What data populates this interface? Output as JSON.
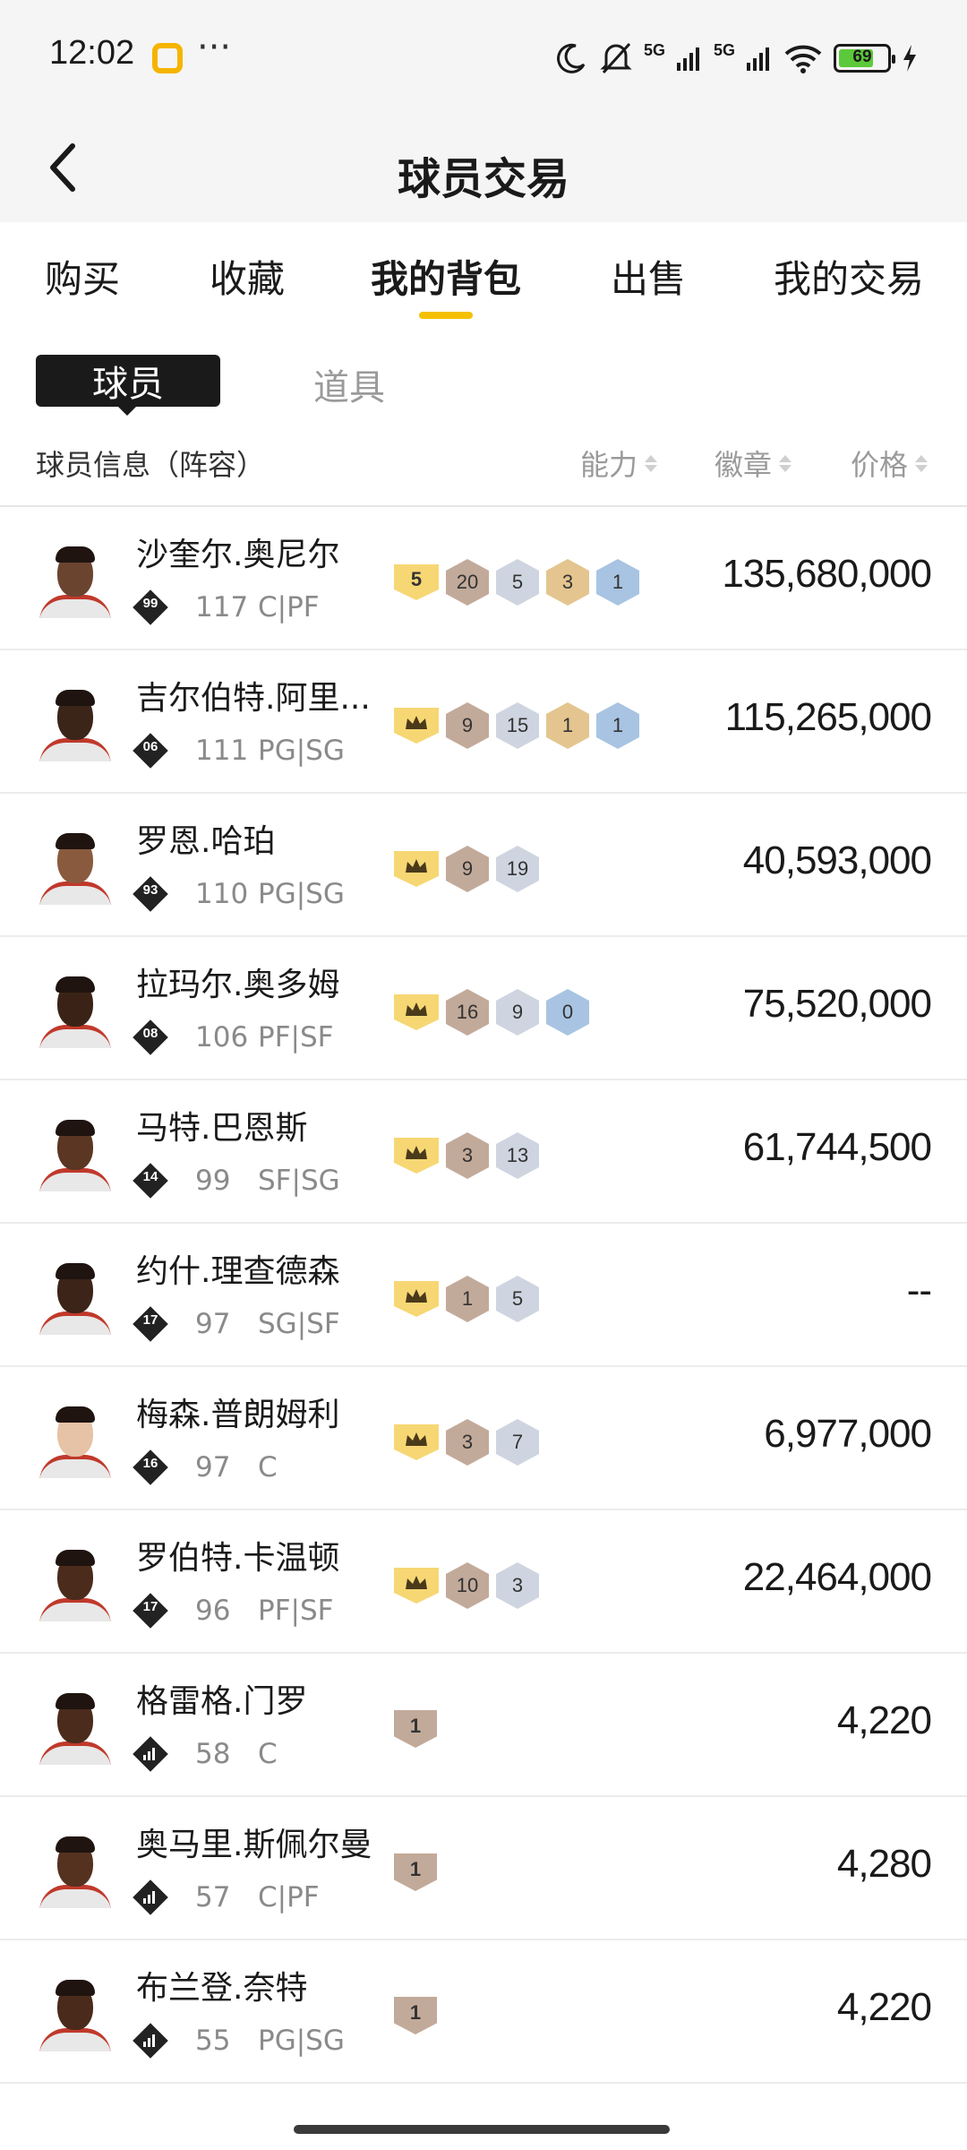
{
  "status_bar": {
    "time": "12:02",
    "battery": "69",
    "network_1": "5G",
    "network_2": "5G",
    "icons": [
      "moon-icon",
      "mute-bell-icon",
      "signal-icon",
      "wifi-icon",
      "battery-icon",
      "charging-icon"
    ]
  },
  "header": {
    "title": "球员交易",
    "back_icon": "chevron-left-icon"
  },
  "tabs": [
    {
      "label": "购买",
      "active": false
    },
    {
      "label": "收藏",
      "active": false
    },
    {
      "label": "我的背包",
      "active": true
    },
    {
      "label": "出售",
      "active": false
    },
    {
      "label": "我的交易",
      "active": false
    }
  ],
  "subtabs": {
    "players": "球员",
    "props": "道具"
  },
  "columns": {
    "info": "球员信息（阵容）",
    "ability": "能力",
    "badge": "徽章",
    "price": "价格"
  },
  "colors": {
    "accent": "#f5c000",
    "active_subtab_bg": "#1a1a1a"
  },
  "players": [
    {
      "name": "沙奎尔.奥尼尔",
      "level": "99",
      "ovr": "117",
      "position": "C|PF",
      "rank": "5",
      "badges": [
        {
          "type": "bronze",
          "count": "20"
        },
        {
          "type": "silver",
          "count": "5"
        },
        {
          "type": "gold",
          "count": "3"
        },
        {
          "type": "blue",
          "count": "1"
        }
      ],
      "price": "135,680,000"
    },
    {
      "name": "吉尔伯特.阿里...",
      "level": "06",
      "ovr": "111",
      "position": "PG|SG",
      "rank": "crown",
      "badges": [
        {
          "type": "bronze",
          "count": "9"
        },
        {
          "type": "silver",
          "count": "15"
        },
        {
          "type": "gold",
          "count": "1"
        },
        {
          "type": "blue",
          "count": "1"
        }
      ],
      "price": "115,265,000"
    },
    {
      "name": "罗恩.哈珀",
      "level": "93",
      "ovr": "110",
      "position": "PG|SG",
      "rank": "crown",
      "badges": [
        {
          "type": "bronze",
          "count": "9"
        },
        {
          "type": "silver",
          "count": "19"
        }
      ],
      "price": "40,593,000"
    },
    {
      "name": "拉玛尔.奥多姆",
      "level": "08",
      "ovr": "106",
      "position": "PF|SF",
      "rank": "crown",
      "badges": [
        {
          "type": "bronze",
          "count": "16"
        },
        {
          "type": "silver",
          "count": "9"
        },
        {
          "type": "blue",
          "count": "0"
        }
      ],
      "price": "75,520,000"
    },
    {
      "name": "马特.巴恩斯",
      "level": "14",
      "ovr": "99",
      "position": "SF|SG",
      "rank": "crown",
      "badges": [
        {
          "type": "bronze",
          "count": "3"
        },
        {
          "type": "silver",
          "count": "13"
        }
      ],
      "price": "61,744,500"
    },
    {
      "name": "约什.理查德森",
      "level": "17",
      "ovr": "97",
      "position": "SG|SF",
      "rank": "crown",
      "badges": [
        {
          "type": "bronze",
          "count": "1"
        },
        {
          "type": "silver",
          "count": "5"
        }
      ],
      "price": "--"
    },
    {
      "name": "梅森.普朗姆利",
      "level": "16",
      "ovr": "97",
      "position": "C",
      "rank": "crown",
      "badges": [
        {
          "type": "bronze",
          "count": "3"
        },
        {
          "type": "silver",
          "count": "7"
        }
      ],
      "price": "6,977,000"
    },
    {
      "name": "罗伯特.卡温顿",
      "level": "17",
      "ovr": "96",
      "position": "PF|SF",
      "rank": "crown",
      "badges": [
        {
          "type": "bronze",
          "count": "10"
        },
        {
          "type": "silver",
          "count": "3"
        }
      ],
      "price": "22,464,000"
    },
    {
      "name": "格雷格.门罗",
      "level": "",
      "ovr": "58",
      "position": "C",
      "rank": "tier",
      "tier": "1",
      "badges": [],
      "price": "4,220"
    },
    {
      "name": "奥马里.斯佩尔曼",
      "level": "",
      "ovr": "57",
      "position": "C|PF",
      "rank": "tier",
      "tier": "1",
      "badges": [],
      "price": "4,280"
    },
    {
      "name": "布兰登.奈特",
      "level": "",
      "ovr": "55",
      "position": "PG|SG",
      "rank": "tier",
      "tier": "1",
      "badges": [],
      "price": "4,220"
    }
  ]
}
